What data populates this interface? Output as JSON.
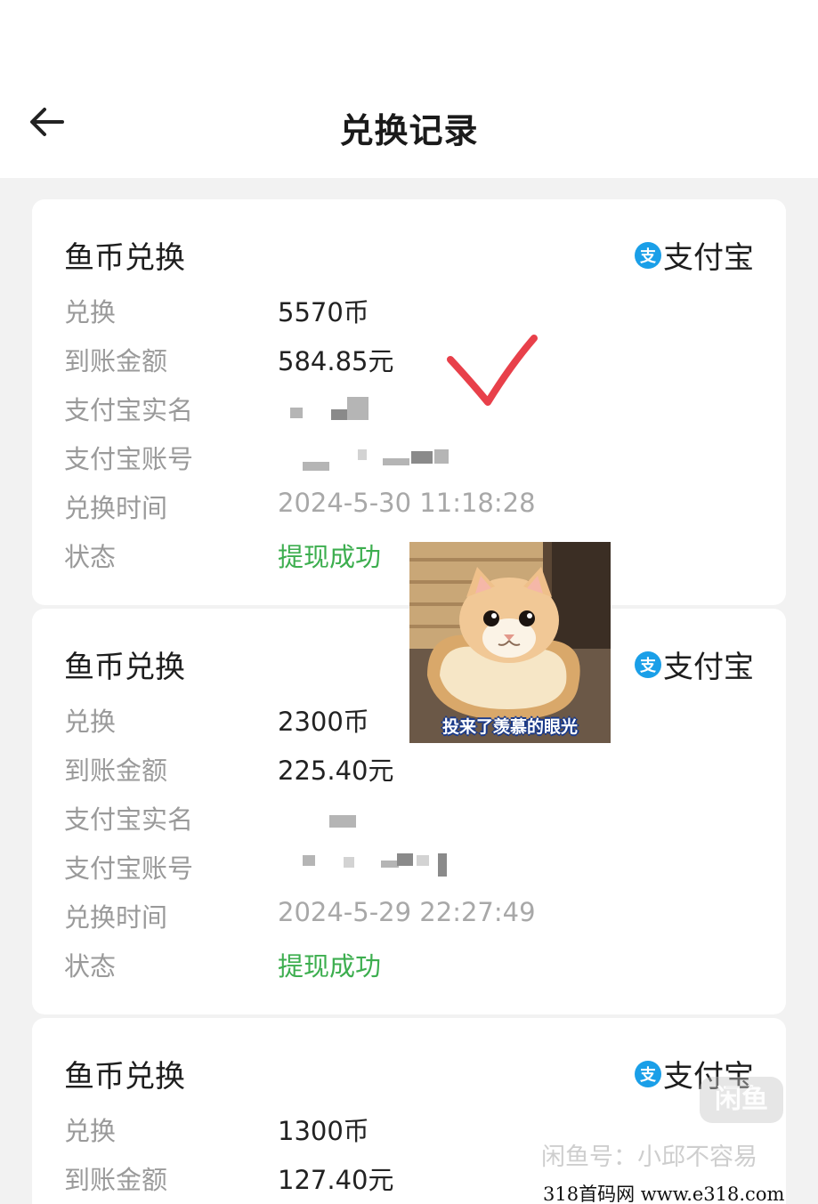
{
  "header": {
    "title": "兑换记录"
  },
  "records": [
    {
      "title": "鱼币兑换",
      "pay_method": "支付宝",
      "fields": {
        "exchange_label": "兑换",
        "exchange_value": "5570币",
        "amount_label": "到账金额",
        "amount_value": "584.85元",
        "realname_label": "支付宝实名",
        "account_label": "支付宝账号",
        "time_label": "兑换时间",
        "time_value": "2024-5-30 11:18:28",
        "status_label": "状态",
        "status_value": "提现成功"
      }
    },
    {
      "title": "鱼币兑换",
      "pay_method": "支付宝",
      "fields": {
        "exchange_label": "兑换",
        "exchange_value": "2300币",
        "amount_label": "到账金额",
        "amount_value": "225.40元",
        "realname_label": "支付宝实名",
        "account_label": "支付宝账号",
        "time_label": "兑换时间",
        "time_value": "2024-5-29 22:27:49",
        "status_label": "状态",
        "status_value": "提现成功"
      }
    },
    {
      "title": "鱼币兑换",
      "pay_method": "支付宝",
      "fields": {
        "exchange_label": "兑换",
        "exchange_value": "1300币",
        "amount_label": "到账金额",
        "amount_value": "127.40元"
      }
    }
  ],
  "alipay_icon_glyph": "支",
  "meme": {
    "caption": "投来了羡慕的眼光"
  },
  "watermark": {
    "logo_text": "闲鱼",
    "user_text": "闲鱼号：小邱不容易"
  },
  "footer": {
    "site_text": "318首码网  www.e318.com"
  },
  "colors": {
    "success": "#3dae4f",
    "alipay": "#1a9fe8",
    "check_mark": "#e8404a"
  }
}
